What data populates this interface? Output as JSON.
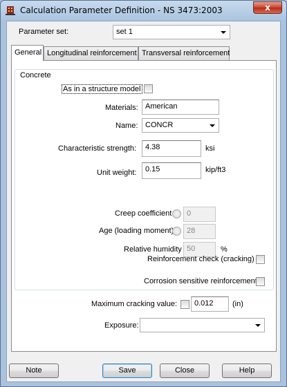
{
  "window": {
    "title": "Calculation Parameter Definition - NS 3473:2003",
    "close_glyph": "x"
  },
  "parameter_set": {
    "label": "Parameter set:",
    "value": "set 1"
  },
  "tabs": [
    {
      "label": "General",
      "active": true
    },
    {
      "label": "Longitudinal reinforcement",
      "active": false
    },
    {
      "label": "Transversal reinforcement",
      "active": false
    }
  ],
  "concrete": {
    "group_title": "Concrete",
    "as_in_structure_model": {
      "label": "As in a structure model",
      "checked": false
    },
    "materials": {
      "label": "Materials:",
      "value": "American"
    },
    "name": {
      "label": "Name:",
      "value": "CONCR"
    },
    "characteristic_strength": {
      "label": "Characteristic strength:",
      "value": "4.38",
      "unit": "ksi"
    },
    "unit_weight": {
      "label": "Unit weight:",
      "value": "0.15",
      "unit": "kip/ft3"
    },
    "creep_coefficient": {
      "label": "Creep coefficient",
      "value": "0"
    },
    "age": {
      "label": "Age (loading moment)",
      "value": "28"
    },
    "relative_humidity": {
      "label": "Relative humidity",
      "value": "50",
      "unit": "%"
    }
  },
  "reinforcement_check": {
    "label": "Reinforcement check (cracking)",
    "checked": false
  },
  "corrosion_sensitive": {
    "label": "Corrosion sensitive reinforcement",
    "checked": false
  },
  "max_cracking": {
    "label": "Maximum cracking value:",
    "value": "0.012",
    "unit": "(in)",
    "checked": false
  },
  "exposure": {
    "label": "Exposure:",
    "value": ""
  },
  "buttons": {
    "note": "Note",
    "save": "Save",
    "close": "Close",
    "help": "Help"
  },
  "colors": {
    "title_close": "#c7432f",
    "default_button_border": "#3c7fb1"
  }
}
